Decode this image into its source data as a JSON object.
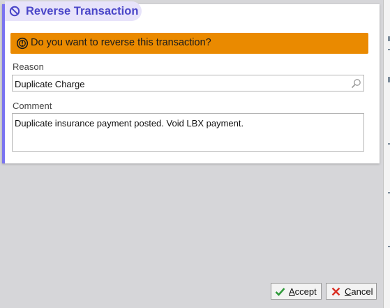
{
  "dialog": {
    "title": "Reverse Transaction",
    "title_icon": "no-entry-icon",
    "warning": {
      "icon": "warning-icon",
      "text": "Do you want to reverse this transaction?",
      "color": "#ea8a00"
    },
    "reason": {
      "label": "Reason",
      "value": "Duplicate Charge",
      "icon": "search-icon"
    },
    "comment": {
      "label": "Comment",
      "value": "Duplicate insurance payment posted. Void LBX payment."
    }
  },
  "buttons": {
    "accept": {
      "mnemonic": "A",
      "rest": "ccept",
      "icon": "checkmark-icon"
    },
    "cancel": {
      "mnemonic": "C",
      "rest": "ancel",
      "icon": "x-icon"
    }
  },
  "colors": {
    "accent": "#7b74f0",
    "title_text": "#4a46c8",
    "title_pill": "#e7e3fa",
    "accept_icon": "#2f9a3a",
    "cancel_icon": "#d93025"
  }
}
